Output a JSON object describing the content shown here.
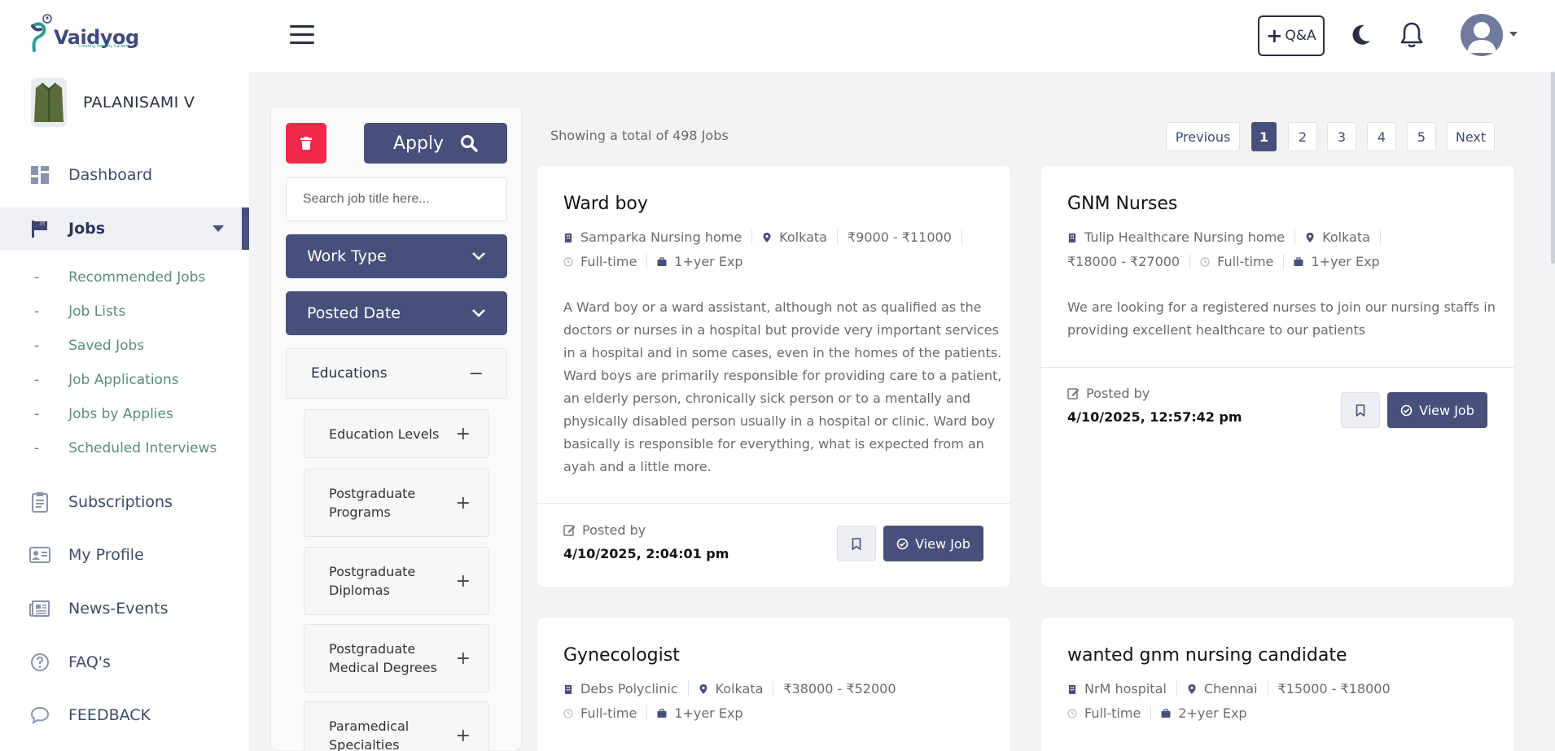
{
  "brand": {
    "name": "Vaidyog",
    "tagline": "Creating Healthy Careers"
  },
  "user": {
    "name": "PALANISAMI V"
  },
  "colors": {
    "primary": "#474f7b",
    "danger": "#f0294a",
    "sub_nav": "#5a8c7a"
  },
  "sidebar": {
    "items": [
      {
        "label": "Dashboard",
        "icon": "dashboard-icon"
      },
      {
        "label": "Jobs",
        "icon": "flag-icon",
        "active": true
      },
      {
        "label": "Subscriptions",
        "icon": "clipboard-icon"
      },
      {
        "label": "My Profile",
        "icon": "id-card-icon"
      },
      {
        "label": "News-Events",
        "icon": "newspaper-icon"
      },
      {
        "label": "FAQ's",
        "icon": "question-icon"
      },
      {
        "label": "FEEDBACK",
        "icon": "chat-icon"
      }
    ],
    "sub_items": [
      {
        "label": "Recommended Jobs"
      },
      {
        "label": "Job Lists"
      },
      {
        "label": "Saved Jobs"
      },
      {
        "label": "Job Applications"
      },
      {
        "label": "Jobs by Applies"
      },
      {
        "label": "Scheduled Interviews"
      }
    ],
    "dash": "-"
  },
  "header": {
    "qa_label": "Q&A",
    "qa_plus": "+"
  },
  "filters": {
    "apply_label": "Apply",
    "search_placeholder": "Search job title here...",
    "work_type_label": "Work Type",
    "posted_date_label": "Posted Date",
    "educations_label": "Educations",
    "educations_toggle": "−",
    "plus": "+",
    "education_items": [
      {
        "label": "Education Levels"
      },
      {
        "label": "Postgraduate Programs"
      },
      {
        "label": "Postgraduate Diplomas"
      },
      {
        "label": "Postgraduate Medical Degrees"
      },
      {
        "label": "Paramedical Specialties"
      }
    ]
  },
  "results": {
    "summary": "Showing a total of 498 Jobs"
  },
  "pagination": {
    "previous": "Previous",
    "next": "Next",
    "pages": [
      "1",
      "2",
      "3",
      "4",
      "5"
    ],
    "current": "1"
  },
  "jobs": [
    {
      "title": "Ward boy",
      "hospital": "Samparka Nursing home",
      "location": "Kolkata",
      "salary": "₹9000 - ₹11000",
      "type": "Full-time",
      "experience": "1+yer Exp",
      "description": [
        "A Ward boy or a ward assistant, although not as qualified as the",
        "doctors or nurses in a hospital but provide very important services",
        "in a hospital and in some cases, even in the homes of the patients.",
        "Ward boys are primarily responsible for providing care to a patient,",
        "an elderly person, chronically sick person or to a mentally and",
        "physically disabled person usually in a hospital or clinic. Ward boy",
        "basically is responsible for everything, what is expected from an",
        "ayah and a little more."
      ],
      "posted_by_label": "Posted by",
      "posted_date": "4/10/2025, 2:04:01 pm",
      "view_label": "View Job"
    },
    {
      "title": "GNM Nurses",
      "hospital": "Tulip Healthcare Nursing home",
      "location": "Kolkata",
      "salary": "₹18000 - ₹27000",
      "type": "Full-time",
      "experience": "1+yer Exp",
      "description": [
        "We are looking for a registered nurses to join our nursing staffs in",
        "providing excellent healthcare to our patients"
      ],
      "posted_by_label": "Posted by",
      "posted_date": "4/10/2025, 12:57:42 pm",
      "view_label": "View Job"
    },
    {
      "title": "Gynecologist",
      "hospital": "Debs Polyclinic",
      "location": "Kolkata",
      "salary": "₹38000 - ₹52000",
      "type": "Full-time",
      "experience": "1+yer Exp"
    },
    {
      "title": "wanted gnm nursing candidate",
      "hospital": "NrM hospital",
      "location": "Chennai",
      "salary": "₹15000 - ₹18000",
      "type": "Full-time",
      "experience": "2+yer Exp"
    }
  ]
}
